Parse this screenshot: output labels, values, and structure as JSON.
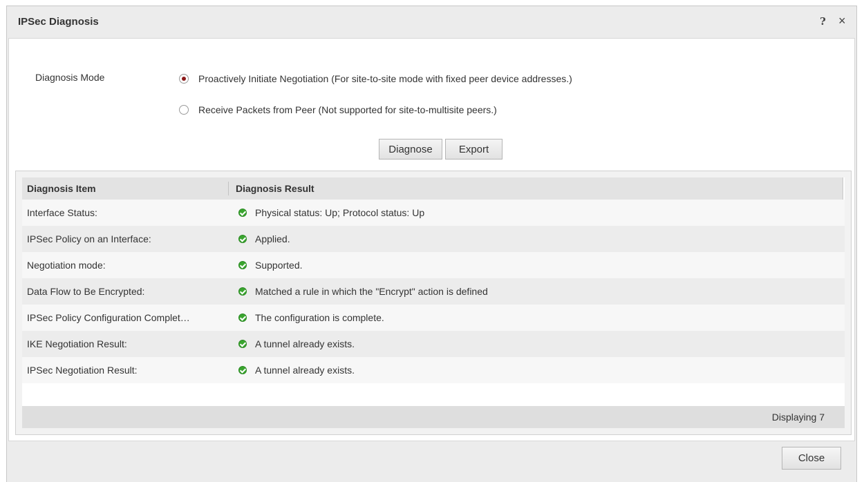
{
  "dialog": {
    "title": "IPSec Diagnosis",
    "help_icon": "?",
    "close_icon": "×"
  },
  "mode": {
    "label": "Diagnosis Mode",
    "options": [
      {
        "label": "Proactively Initiate Negotiation (For site-to-site mode with fixed peer device addresses.)",
        "checked": true
      },
      {
        "label": "Receive Packets from Peer (Not supported for site-to-multisite peers.)",
        "checked": false
      }
    ]
  },
  "actions": {
    "diagnose_label": "Diagnose",
    "export_label": "Export"
  },
  "grid": {
    "columns": [
      "Diagnosis Item",
      "Diagnosis Result"
    ],
    "rows": [
      {
        "item": "Interface Status:",
        "result": "Physical status: Up; Protocol status: Up",
        "status": "ok"
      },
      {
        "item": "IPSec Policy on an Interface:",
        "result": "Applied.",
        "status": "ok"
      },
      {
        "item": "Negotiation mode:",
        "result": "Supported.",
        "status": "ok"
      },
      {
        "item": "Data Flow to Be Encrypted:",
        "result": "Matched a rule in which the \"Encrypt\" action is defined",
        "status": "ok"
      },
      {
        "item": "IPSec Policy Configuration Complet…",
        "result": "The configuration is complete.",
        "status": "ok"
      },
      {
        "item": "IKE Negotiation Result:",
        "result": "A tunnel already exists.",
        "status": "ok"
      },
      {
        "item": "IPSec Negotiation Result:",
        "result": "A tunnel already exists.",
        "status": "ok"
      }
    ],
    "pager_text": "Displaying 7"
  },
  "footer": {
    "close_label": "Close"
  },
  "colors": {
    "ok": "#3aa52f",
    "radio_selected": "#8b1a1a"
  }
}
